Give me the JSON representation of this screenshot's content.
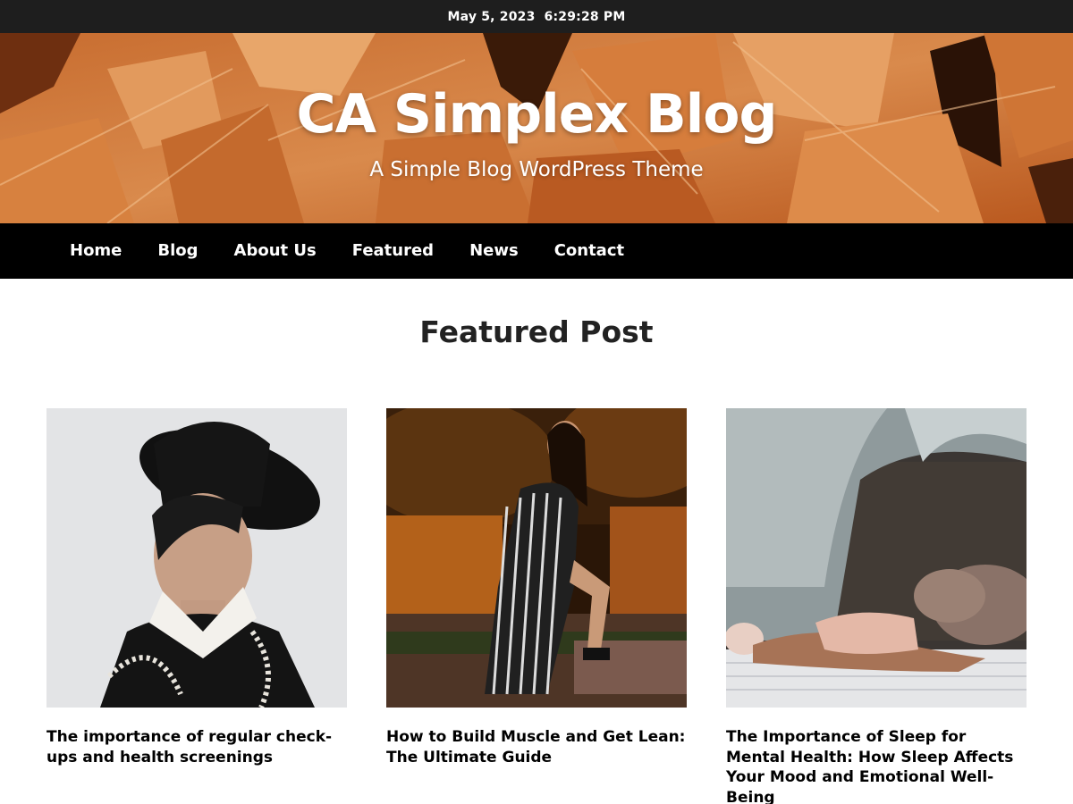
{
  "topbar": {
    "date": "May 5, 2023",
    "time": "6:29:28 PM"
  },
  "site": {
    "title": "CA Simplex Blog",
    "tagline": "A Simple Blog WordPress Theme"
  },
  "nav": {
    "items": [
      {
        "label": "Home"
      },
      {
        "label": "Blog"
      },
      {
        "label": "About Us"
      },
      {
        "label": "Featured"
      },
      {
        "label": "News"
      },
      {
        "label": "Contact"
      }
    ]
  },
  "featured": {
    "heading": "Featured Post",
    "posts": [
      {
        "title": "The importance of regular check-ups and health screenings",
        "image": "woman-in-black-hat-photo"
      },
      {
        "title": "How to Build Muscle and Get Lean: The Ultimate Guide",
        "image": "woman-in-striped-dress-photo"
      },
      {
        "title": "The Importance of Sleep for Mental Health: How Sleep Affects Your Mood and Emotional Well-Being",
        "image": "woman-sleeping-in-bed-photo"
      }
    ]
  },
  "colors": {
    "topbar_bg": "#1e1e1e",
    "header_leaf_orange": "#c8692a",
    "nav_bg": "#000000",
    "text_dark": "#222222"
  }
}
